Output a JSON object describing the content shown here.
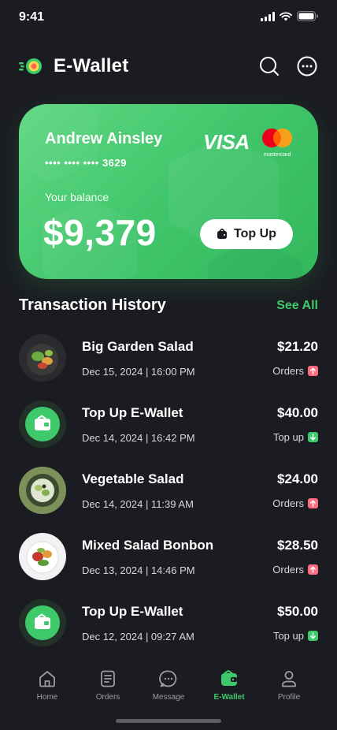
{
  "status": {
    "time": "9:41"
  },
  "header": {
    "title": "E-Wallet",
    "search_icon": "search-icon",
    "more_icon": "more-icon"
  },
  "card": {
    "holder": "Andrew Ainsley",
    "number": "•••• •••• •••• 3629",
    "balance_label": "Your balance",
    "balance": "$9,379",
    "visa": "VISA",
    "mastercard": "mastercard",
    "topup_label": "Top Up"
  },
  "history": {
    "title": "Transaction History",
    "see_all": "See All",
    "items": [
      {
        "name": "Big Garden Salad",
        "date": "Dec 15, 2024 | 16:00 PM",
        "amount": "$21.20",
        "type": "Orders",
        "direction": "up"
      },
      {
        "name": "Top Up E-Wallet",
        "date": "Dec 14, 2024 | 16:42 PM",
        "amount": "$40.00",
        "type": "Top up",
        "direction": "down"
      },
      {
        "name": "Vegetable Salad",
        "date": "Dec 14, 2024 | 11:39 AM",
        "amount": "$24.00",
        "type": "Orders",
        "direction": "up"
      },
      {
        "name": "Mixed Salad Bonbon",
        "date": "Dec 13, 2024 | 14:46 PM",
        "amount": "$28.50",
        "type": "Orders",
        "direction": "up"
      },
      {
        "name": "Top Up E-Wallet",
        "date": "Dec 12, 2024 | 09:27 AM",
        "amount": "$50.00",
        "type": "Top up",
        "direction": "down"
      }
    ]
  },
  "nav": {
    "items": [
      {
        "label": "Home"
      },
      {
        "label": "Orders"
      },
      {
        "label": "Message"
      },
      {
        "label": "E-Wallet"
      },
      {
        "label": "Profile"
      }
    ],
    "active": "E-Wallet"
  },
  "colors": {
    "accent": "#3ec96a",
    "background": "#1b1c21",
    "orders_badge": "#ff6b81"
  }
}
